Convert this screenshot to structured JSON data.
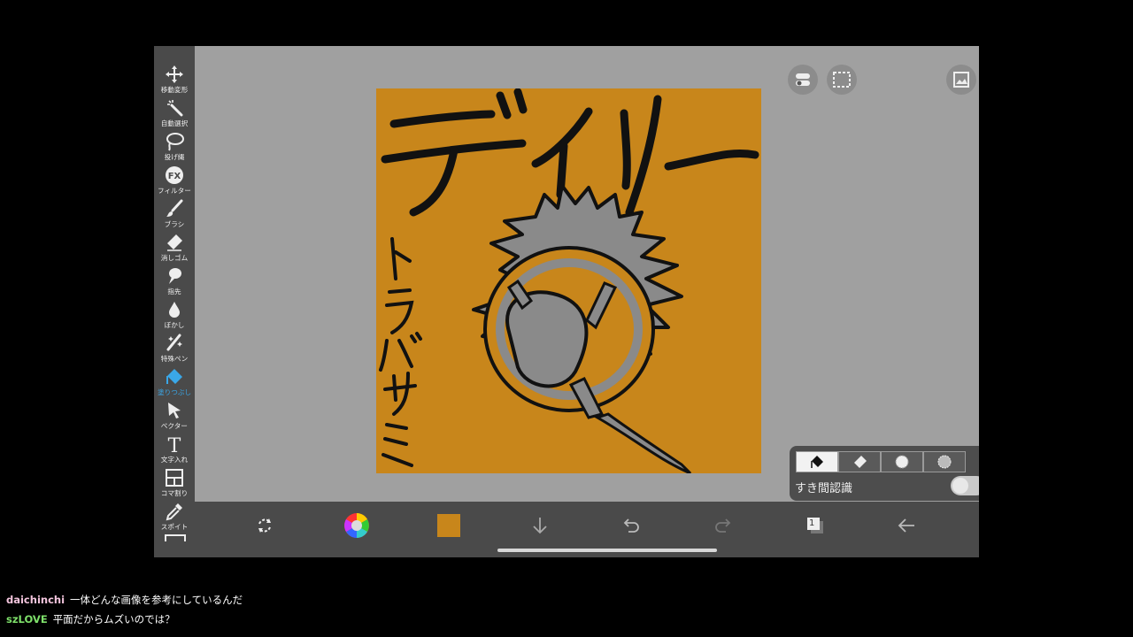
{
  "toolbar": {
    "tools": [
      {
        "name": "move-transform",
        "label": "移動変形",
        "icon": "move-icon"
      },
      {
        "name": "auto-select",
        "label": "自動選択",
        "icon": "magic-wand-icon"
      },
      {
        "name": "lasso",
        "label": "投げ縄",
        "icon": "lasso-icon"
      },
      {
        "name": "filter",
        "label": "フィルター",
        "icon": "fx-icon"
      },
      {
        "name": "brush",
        "label": "ブラシ",
        "icon": "brush-icon"
      },
      {
        "name": "eraser",
        "label": "消しゴム",
        "icon": "eraser-icon"
      },
      {
        "name": "finger",
        "label": "指先",
        "icon": "finger-icon"
      },
      {
        "name": "blur",
        "label": "ぼかし",
        "icon": "drop-icon"
      },
      {
        "name": "special-pen",
        "label": "特殊ペン",
        "icon": "special-pen-icon"
      },
      {
        "name": "fill",
        "label": "塗りつぶし",
        "icon": "bucket-icon"
      },
      {
        "name": "vector",
        "label": "ベクター",
        "icon": "cursor-icon"
      },
      {
        "name": "text",
        "label": "文字入れ",
        "icon": "text-icon"
      },
      {
        "name": "frame-divider",
        "label": "コマ割り",
        "icon": "panel-icon"
      },
      {
        "name": "eyedropper",
        "label": "スポイト",
        "icon": "eyedropper-icon"
      }
    ],
    "active_tool": "fill"
  },
  "top_buttons": [
    {
      "name": "toggle-button",
      "icon": "toggle-icon"
    },
    {
      "name": "selection-button",
      "icon": "dashed-rect-icon"
    },
    {
      "name": "material-button",
      "icon": "image-icon"
    }
  ],
  "fill_panel": {
    "modes": [
      "fill-icon",
      "eraser-icon",
      "circle-icon",
      "pattern-icon"
    ],
    "active_mode": "fill-icon",
    "gap_label": "すき間認識",
    "gap_enabled": false
  },
  "bottom_bar": {
    "buttons": [
      "transform-icon",
      "color-wheel-icon",
      "current-color",
      "down-arrow-icon",
      "undo-icon",
      "redo-icon",
      "layers-icon",
      "back-arrow-icon"
    ],
    "current_color": "#c8861b",
    "layer_count": "1"
  },
  "canvas": {
    "background": "#c8861b"
  },
  "chat": [
    {
      "user": "daichinchi",
      "message": "一体どんな画像を参考にしているんだ",
      "color": "#f2c4dc"
    },
    {
      "user": "szLOVE",
      "message": "平面だからムズいのでは？",
      "color": "#7ee06a"
    }
  ]
}
